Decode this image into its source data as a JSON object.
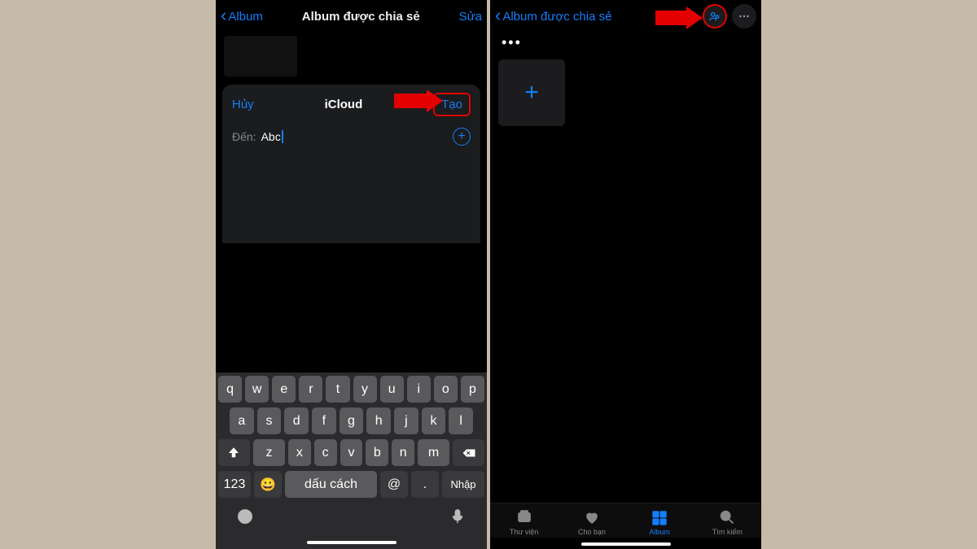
{
  "left": {
    "nav": {
      "back": "Album",
      "title": "Album được chia sẻ",
      "edit": "Sửa"
    },
    "sheet": {
      "cancel": "Hủy",
      "title": "iCloud",
      "create": "Tạo",
      "to_label": "Đến:",
      "to_value": "Abc"
    },
    "keyboard": {
      "row1": [
        "q",
        "w",
        "e",
        "r",
        "t",
        "y",
        "u",
        "i",
        "o",
        "p"
      ],
      "row2": [
        "a",
        "s",
        "d",
        "f",
        "g",
        "h",
        "j",
        "k",
        "l"
      ],
      "row3": [
        "z",
        "x",
        "c",
        "v",
        "b",
        "n",
        "m"
      ],
      "numKey": "123",
      "space": "dấu cách",
      "at": "@",
      "dot": ".",
      "enter": "Nhập"
    }
  },
  "right": {
    "nav": {
      "back": "Album được chia sẻ"
    },
    "dots": "•••",
    "tabs": {
      "library": "Thư viện",
      "foryou": "Cho bạn",
      "album": "Album",
      "search": "Tìm kiếm"
    }
  }
}
